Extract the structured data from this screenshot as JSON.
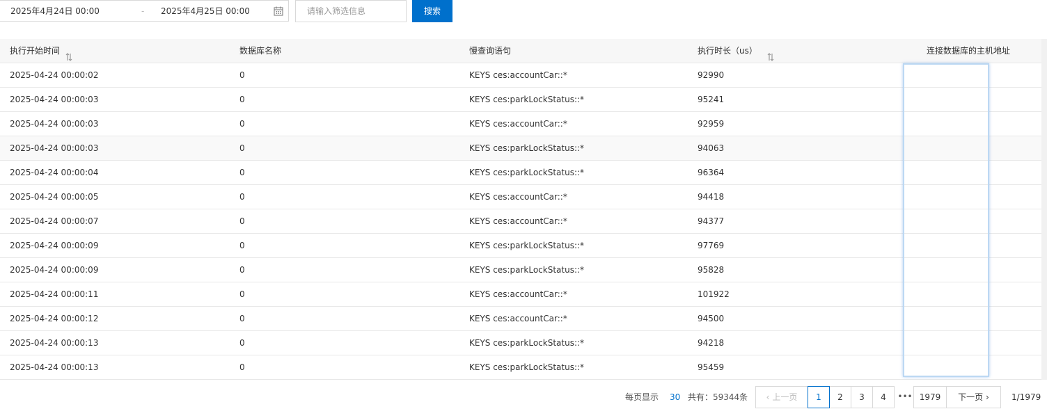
{
  "filter": {
    "start_date": "2025年4月24日 00:00",
    "separator": "-",
    "end_date": "2025年4月25日 00:00",
    "calendar_icon": "calendar-icon",
    "input_placeholder": "请输入筛选信息",
    "search_label": "搜索"
  },
  "table": {
    "columns": [
      {
        "label": "执行开始时间",
        "sortable": true
      },
      {
        "label": "数据库名称",
        "sortable": false
      },
      {
        "label": "慢查询语句",
        "sortable": false
      },
      {
        "label": "执行时长（us）",
        "sortable": true
      },
      {
        "label": "连接数据库的主机地址",
        "sortable": false
      }
    ],
    "rows": [
      {
        "time": "2025-04-24 00:00:02",
        "db": "0",
        "query": "KEYS ces:accountCar::*",
        "duration": "92990",
        "host": ""
      },
      {
        "time": "2025-04-24 00:00:03",
        "db": "0",
        "query": "KEYS ces:parkLockStatus::*",
        "duration": "95241",
        "host": ""
      },
      {
        "time": "2025-04-24 00:00:03",
        "db": "0",
        "query": "KEYS ces:accountCar::*",
        "duration": "92959",
        "host": ""
      },
      {
        "time": "2025-04-24 00:00:03",
        "db": "0",
        "query": "KEYS ces:parkLockStatus::*",
        "duration": "94063",
        "host": ""
      },
      {
        "time": "2025-04-24 00:00:04",
        "db": "0",
        "query": "KEYS ces:parkLockStatus::*",
        "duration": "96364",
        "host": ""
      },
      {
        "time": "2025-04-24 00:00:05",
        "db": "0",
        "query": "KEYS ces:accountCar::*",
        "duration": "94418",
        "host": ""
      },
      {
        "time": "2025-04-24 00:00:07",
        "db": "0",
        "query": "KEYS ces:accountCar::*",
        "duration": "94377",
        "host": ""
      },
      {
        "time": "2025-04-24 00:00:09",
        "db": "0",
        "query": "KEYS ces:parkLockStatus::*",
        "duration": "97769",
        "host": ""
      },
      {
        "time": "2025-04-24 00:00:09",
        "db": "0",
        "query": "KEYS ces:parkLockStatus::*",
        "duration": "95828",
        "host": ""
      },
      {
        "time": "2025-04-24 00:00:11",
        "db": "0",
        "query": "KEYS ces:accountCar::*",
        "duration": "101922",
        "host": ""
      },
      {
        "time": "2025-04-24 00:00:12",
        "db": "0",
        "query": "KEYS ces:accountCar::*",
        "duration": "94500",
        "host": ""
      },
      {
        "time": "2025-04-24 00:00:13",
        "db": "0",
        "query": "KEYS ces:parkLockStatus::*",
        "duration": "94218",
        "host": ""
      },
      {
        "time": "2025-04-24 00:00:13",
        "db": "0",
        "query": "KEYS ces:parkLockStatus::*",
        "duration": "95459",
        "host": ""
      }
    ]
  },
  "pagination": {
    "page_size_label": "每页显示",
    "page_size": "30",
    "total_label": "共有：59344条",
    "prev_label": "上一页",
    "next_label": "下一页",
    "pages": [
      "1",
      "2",
      "3",
      "4"
    ],
    "current_page": "1",
    "ellipsis": "•••",
    "last_page": "1979",
    "page_of": "1/1979"
  },
  "colors": {
    "accent": "#0070cc",
    "header_bg": "#f7f7f7",
    "border": "#e8e8e8",
    "highlight_border": "#bcd8f3"
  }
}
